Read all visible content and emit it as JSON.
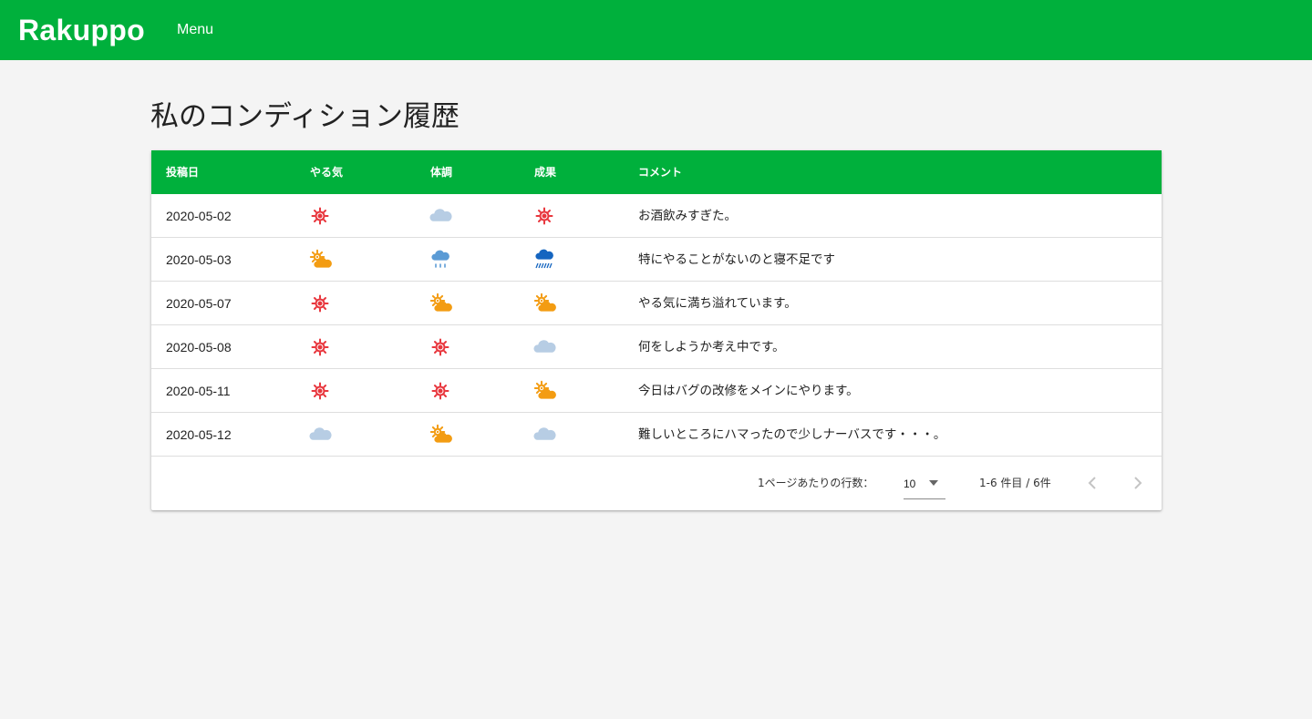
{
  "header": {
    "brand": "Rakuppo",
    "menu_label": "Menu",
    "color": "#00b03c"
  },
  "page_title": "私のコンディション履歴",
  "table": {
    "columns": [
      "投稿日",
      "やる気",
      "体調",
      "成果",
      "コメント"
    ],
    "rows": [
      {
        "date": "2020-05-02",
        "motivation": "sunny-icon",
        "health": "cloudy-icon",
        "result": "sunny-icon",
        "comment": "お酒飲みすぎた。"
      },
      {
        "date": "2020-05-03",
        "motivation": "partly-cloudy-icon",
        "health": "light-rain-icon",
        "result": "heavy-rain-icon",
        "comment": "特にやることがないのと寝不足です"
      },
      {
        "date": "2020-05-07",
        "motivation": "sunny-icon",
        "health": "partly-cloudy-icon",
        "result": "partly-cloudy-icon",
        "comment": "やる気に満ち溢れています。"
      },
      {
        "date": "2020-05-08",
        "motivation": "sunny-icon",
        "health": "sunny-icon",
        "result": "cloudy-icon",
        "comment": "何をしようか考え中です。"
      },
      {
        "date": "2020-05-11",
        "motivation": "sunny-icon",
        "health": "sunny-icon",
        "result": "partly-cloudy-icon",
        "comment": "今日はバグの改修をメインにやります。"
      },
      {
        "date": "2020-05-12",
        "motivation": "cloudy-icon",
        "health": "partly-cloudy-icon",
        "result": "cloudy-icon",
        "comment": "難しいところにハマったので少しナーバスです・・・。"
      }
    ]
  },
  "pagination": {
    "rows_per_page_label": "1ページあたりの行数：",
    "rows_per_page_value": "10",
    "range_text": "1-6 件目 / 6件",
    "prev_icon": "chevron-left-icon",
    "next_icon": "chevron-right-icon"
  },
  "colors": {
    "sunny": "#e8363d",
    "partly_cloudy": "#f39c12",
    "cloudy": "#b7cde4",
    "light_rain": "#5b9bd5",
    "heavy_rain": "#1565c0"
  }
}
